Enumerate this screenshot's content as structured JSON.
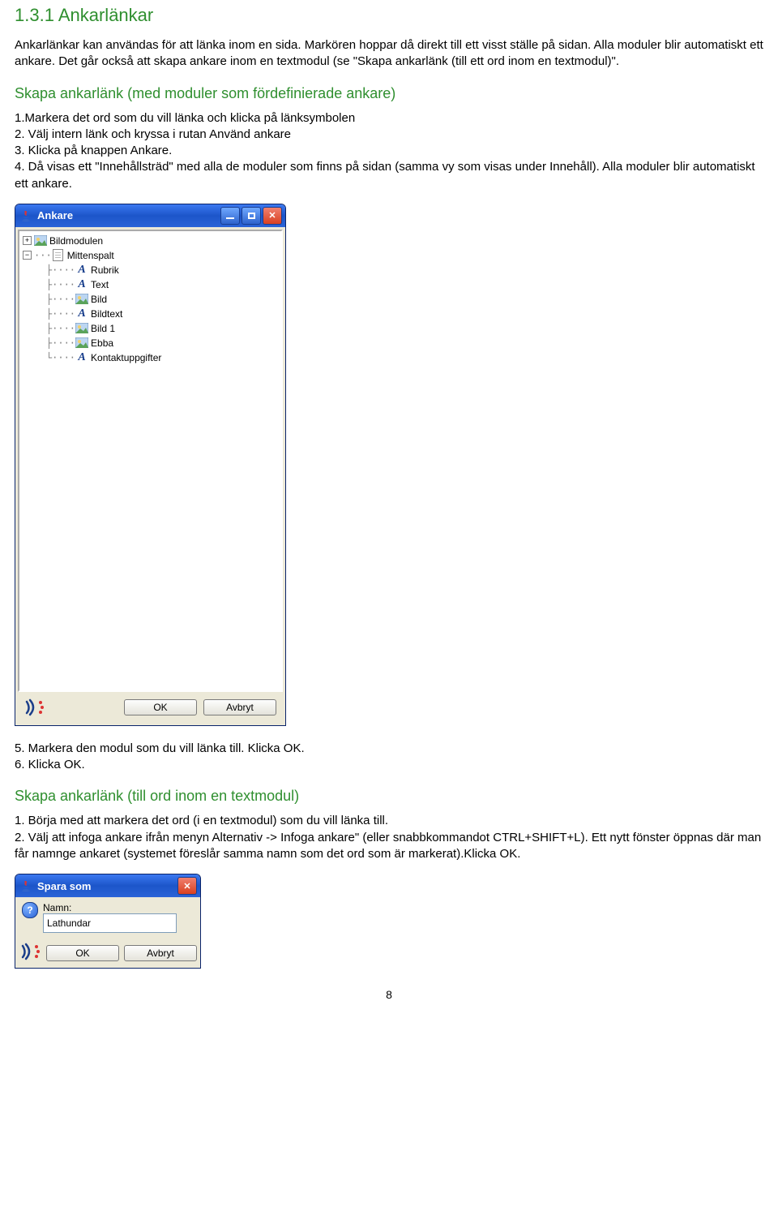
{
  "heading": "1.3.1 Ankarlänkar",
  "intro": "Ankarlänkar kan användas för att länka inom en sida. Markören hoppar då direkt till ett visst ställe på sidan. Alla moduler blir automatiskt ett ankare. Det går också att skapa ankare inom en textmodul (se \"Skapa ankarlänk (till ett ord inom en textmodul)\".",
  "sub1": "Skapa ankarlänk (med moduler som fördefinierade ankare)",
  "list1": {
    "l1": "1.Markera det ord som du vill länka och klicka på länksymbolen",
    "l2": "2. Välj intern länk och kryssa i rutan Använd ankare",
    "l3": "3. Klicka på knappen Ankare.",
    "l4": "4. Då visas ett \"Innehållsträd\" med alla de moduler som finns på sidan (samma vy som visas under Innehåll). Alla moduler blir automatiskt ett ankare."
  },
  "dialog1": {
    "title": "Ankare",
    "ok": "OK",
    "cancel": "Avbryt",
    "tree": {
      "bildmodulen": "Bildmodulen",
      "mittenspalt": "Mittenspalt",
      "rubrik": "Rubrik",
      "text": "Text",
      "bild": "Bild",
      "bildtext": "Bildtext",
      "bild1": "Bild 1",
      "ebba": "Ebba",
      "kontakt": "Kontaktuppgifter"
    }
  },
  "list1b": {
    "l5": "5. Markera den modul som du vill länka till. Klicka OK.",
    "l6": "6. Klicka OK."
  },
  "sub2": "Skapa ankarlänk (till ord inom en textmodul)",
  "list2": {
    "l1": "1. Börja med att markera det ord (i en textmodul) som du vill länka till.",
    "l2": "2. Välj att infoga ankare ifrån menyn Alternativ -> Infoga ankare\" (eller snabbkommandot CTRL+SHIFT+L). Ett nytt fönster öppnas där man får namnge ankaret (systemet föreslår samma namn som det ord som är markerat).Klicka OK."
  },
  "dialog2": {
    "title": "Spara som",
    "name_label": "Namn:",
    "name_value": "Lathundar",
    "ok": "OK",
    "cancel": "Avbryt"
  },
  "page_number": "8"
}
